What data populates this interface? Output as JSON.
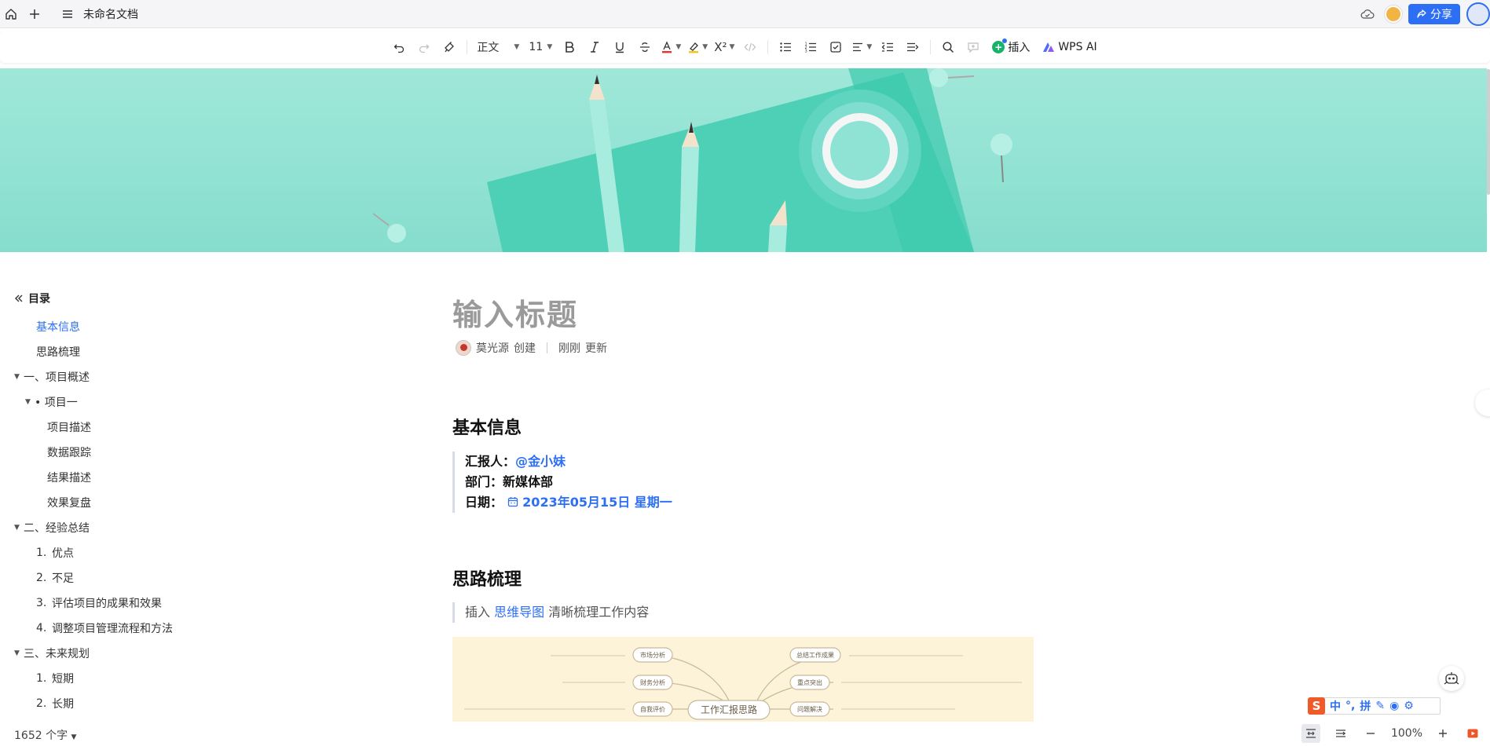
{
  "window": {
    "doc_title": "未命名文档"
  },
  "header": {
    "share_label": "分享"
  },
  "toolbar": {
    "style_value": "正文",
    "size_value": "11",
    "insert_label": "插入",
    "ai_label": "WPS AI",
    "colors": {
      "font_color": "#e53935",
      "highlight": "#f5c518",
      "accent": "#2c6ff4",
      "insert_green": "#18b36b"
    }
  },
  "sidebar": {
    "header": "目录",
    "items": [
      {
        "label": "基本信息"
      },
      {
        "label": "思路梳理"
      },
      {
        "label": "一、项目概述"
      },
      {
        "label": "• 项目一"
      },
      {
        "label": "项目描述"
      },
      {
        "label": "数据跟踪"
      },
      {
        "label": "结果描述"
      },
      {
        "label": "效果复盘"
      },
      {
        "label": "二、经验总结"
      },
      {
        "num": "1.",
        "label": "优点"
      },
      {
        "num": "2.",
        "label": "不足"
      },
      {
        "num": "3.",
        "label": "评估项目的成果和效果"
      },
      {
        "num": "4.",
        "label": "调整项目管理流程和方法"
      },
      {
        "label": "三、未来规划"
      },
      {
        "num": "1.",
        "label": "短期"
      },
      {
        "num": "2.",
        "label": "长期"
      }
    ]
  },
  "doc": {
    "title_placeholder": "输入标题",
    "author": "莫光源",
    "created": "创建",
    "updated_time": "刚刚",
    "updated": "更新",
    "section1": {
      "heading": "基本信息",
      "reporter_label": "汇报人：",
      "reporter_value": "@金小妹",
      "dept_label": "部门：",
      "dept_value": "新媒体部",
      "date_label": "日期：",
      "date_value": "2023年05月15日 星期一"
    },
    "section2": {
      "heading": "思路梳理",
      "hint_prefix": "插入",
      "hint_link": "思维导图",
      "hint_suffix": "清晰梳理工作内容",
      "mindmap": {
        "center": "工作汇报思路",
        "left_nodes": [
          "市场分析",
          "财务分析",
          "自我评价"
        ],
        "right_nodes": [
          "总结工作成果",
          "重点突出",
          "问题解决"
        ]
      }
    }
  },
  "status": {
    "word_count": "1652 个字",
    "zoom": "100%"
  },
  "ime": {
    "chinese": "中",
    "punct": "°,",
    "pinyin": "拼"
  }
}
